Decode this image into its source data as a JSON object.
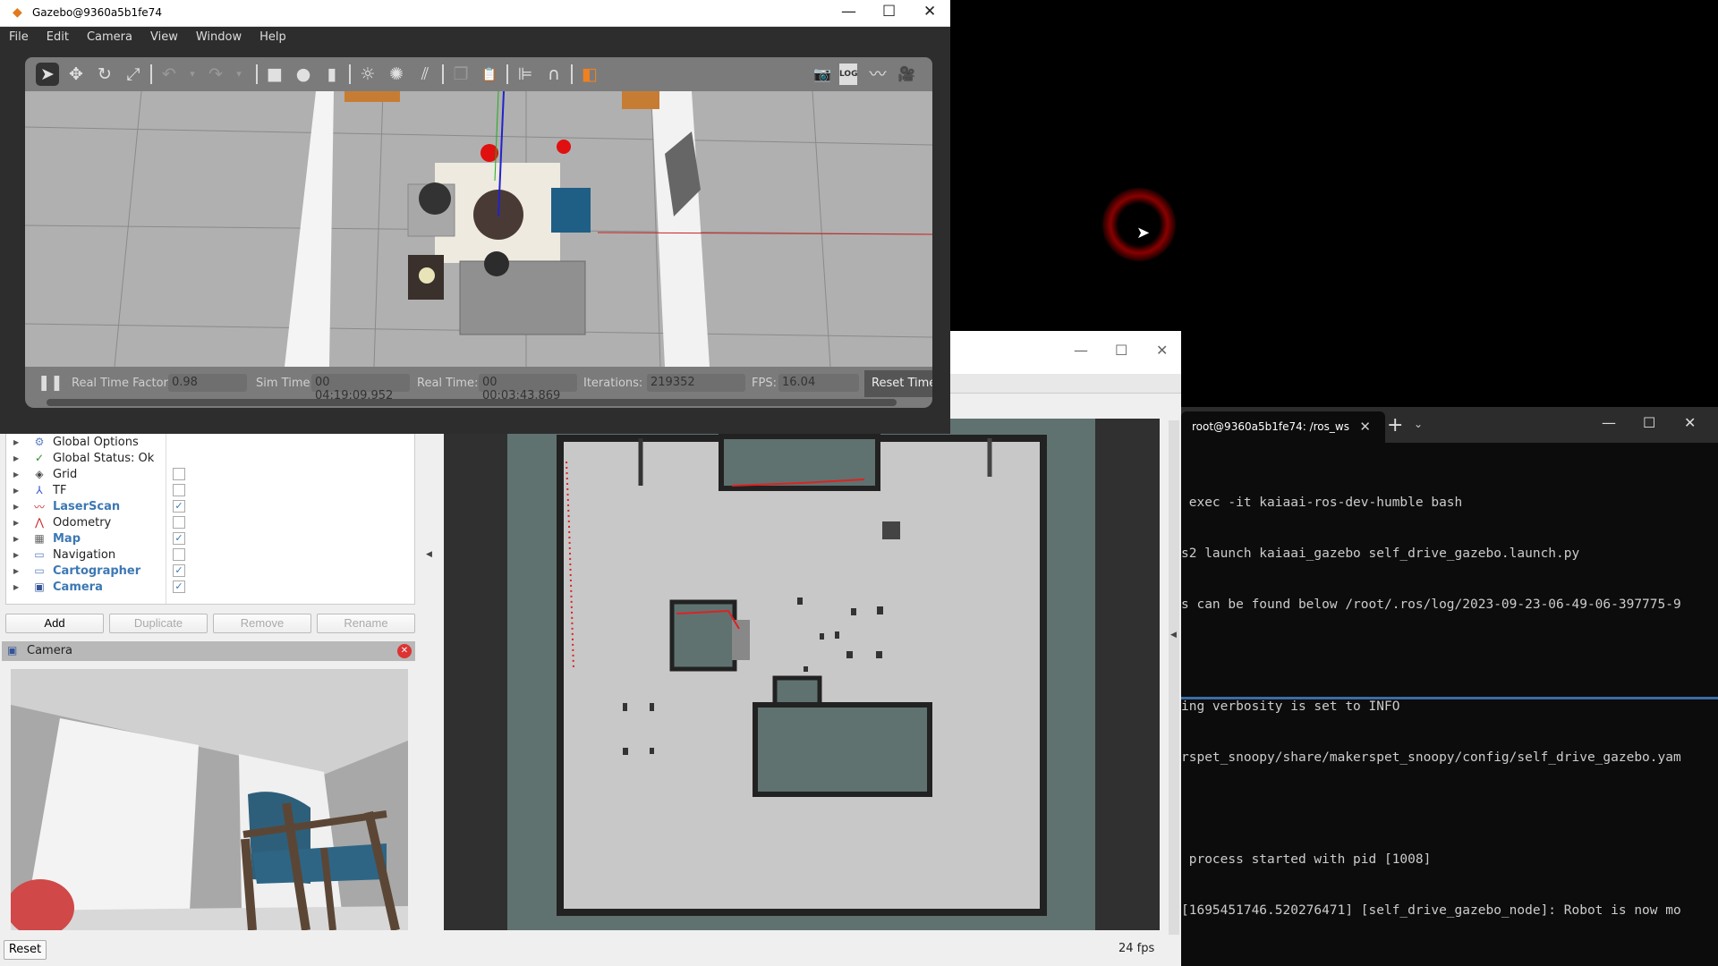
{
  "gazebo": {
    "title": "Gazebo@9360a5b1fe74",
    "window_controls": {
      "minimize": "—",
      "maximize": "☐",
      "close": "✕"
    },
    "menu": [
      "File",
      "Edit",
      "Camera",
      "View",
      "Window",
      "Help"
    ],
    "toolbar": [
      {
        "name": "select-mode",
        "glyph": "➤"
      },
      {
        "name": "translate-mode",
        "glyph": "✥"
      },
      {
        "name": "rotate-mode",
        "glyph": "↻"
      },
      {
        "name": "scale-mode",
        "glyph": "⤢"
      },
      {
        "name": "undo",
        "glyph": "↶"
      },
      {
        "name": "undo-dropdown",
        "glyph": "▾"
      },
      {
        "name": "redo",
        "glyph": "↷"
      },
      {
        "name": "redo-dropdown",
        "glyph": "▾"
      },
      {
        "name": "box-shape",
        "glyph": "■"
      },
      {
        "name": "sphere-shape",
        "glyph": "●"
      },
      {
        "name": "cylinder-shape",
        "glyph": "▮"
      },
      {
        "name": "point-light",
        "glyph": "☼"
      },
      {
        "name": "spot-light",
        "glyph": "✺"
      },
      {
        "name": "directional-light",
        "glyph": "⫽"
      },
      {
        "name": "copy",
        "glyph": "❐"
      },
      {
        "name": "paste",
        "glyph": "📋"
      },
      {
        "name": "align",
        "glyph": "⊫"
      },
      {
        "name": "snap",
        "glyph": "∩"
      },
      {
        "name": "view-angle",
        "glyph": "◧"
      }
    ],
    "toolbar_right": [
      {
        "name": "screenshot",
        "glyph": "📷"
      },
      {
        "name": "log",
        "glyph": "LOG"
      },
      {
        "name": "plot",
        "glyph": "〰"
      },
      {
        "name": "record-video",
        "glyph": "🎥"
      }
    ],
    "status": {
      "real_time_factor_label": "Real Time Factor:",
      "real_time_factor": "0.98",
      "sim_time_label": "Sim Time:",
      "sim_time": "00 04:19:09.952",
      "real_time_label": "Real Time:",
      "real_time": "00 00:03:43.869",
      "iterations_label": "Iterations:",
      "iterations": "219352",
      "fps_label": "FPS:",
      "fps": "16.04",
      "reset_time": "Reset Time"
    }
  },
  "rviz": {
    "window_controls": {
      "minimize": "—",
      "maximize": "☐",
      "close": "✕"
    },
    "displays": [
      {
        "label": "Global Options",
        "icon": "⚙",
        "icon_color": "#5b7fc4",
        "highlight": false,
        "checkbox": null
      },
      {
        "label": "Global Status: Ok",
        "icon": "✓",
        "icon_color": "#2e8b2e",
        "highlight": false,
        "checkbox": null
      },
      {
        "label": "Grid",
        "icon": "◈",
        "icon_color": "#444",
        "highlight": false,
        "checkbox": false
      },
      {
        "label": "TF",
        "icon": "⅄",
        "icon_color": "#3355cc",
        "highlight": false,
        "checkbox": false
      },
      {
        "label": "LaserScan",
        "icon": "〰",
        "icon_color": "#cc2222",
        "highlight": true,
        "checkbox": true
      },
      {
        "label": "Odometry",
        "icon": "⋀",
        "icon_color": "#cc2222",
        "highlight": false,
        "checkbox": false
      },
      {
        "label": "Map",
        "icon": "▦",
        "icon_color": "#666",
        "highlight": true,
        "checkbox": true
      },
      {
        "label": "Navigation",
        "icon": "▭",
        "icon_color": "#5b7fc4",
        "highlight": false,
        "checkbox": false
      },
      {
        "label": "Cartographer",
        "icon": "▭",
        "icon_color": "#5b7fc4",
        "highlight": true,
        "checkbox": true
      },
      {
        "label": "Camera",
        "icon": "▣",
        "icon_color": "#335599",
        "highlight": true,
        "checkbox": true
      }
    ],
    "buttons": {
      "add": "Add",
      "duplicate": "Duplicate",
      "remove": "Remove",
      "rename": "Rename"
    },
    "camera_panel_title": "Camera",
    "reset": "Reset",
    "fps": "24 fps"
  },
  "terminal": {
    "tab_title": "root@9360a5b1fe74: /ros_ws",
    "tab_close": "✕",
    "new_tab": "+",
    "dropdown": "⌄",
    "window_controls": {
      "minimize": "—",
      "maximize": "☐",
      "close": "✕"
    },
    "lines": [
      " exec -it kaiaai-ros-dev-humble bash",
      "s2 launch kaiaai_gazebo self_drive_gazebo.launch.py",
      "s can be found below /root/.ros/log/2023-09-23-06-49-06-397775-9",
      "",
      "ing verbosity is set to INFO",
      "rspet_snoopy/share/makerspet_snoopy/config/self_drive_gazebo.yam",
      "",
      " process started with pid [1008]",
      "[1695451746.520276471] [self_drive_gazebo_node]: Robot is now mo"
    ]
  }
}
